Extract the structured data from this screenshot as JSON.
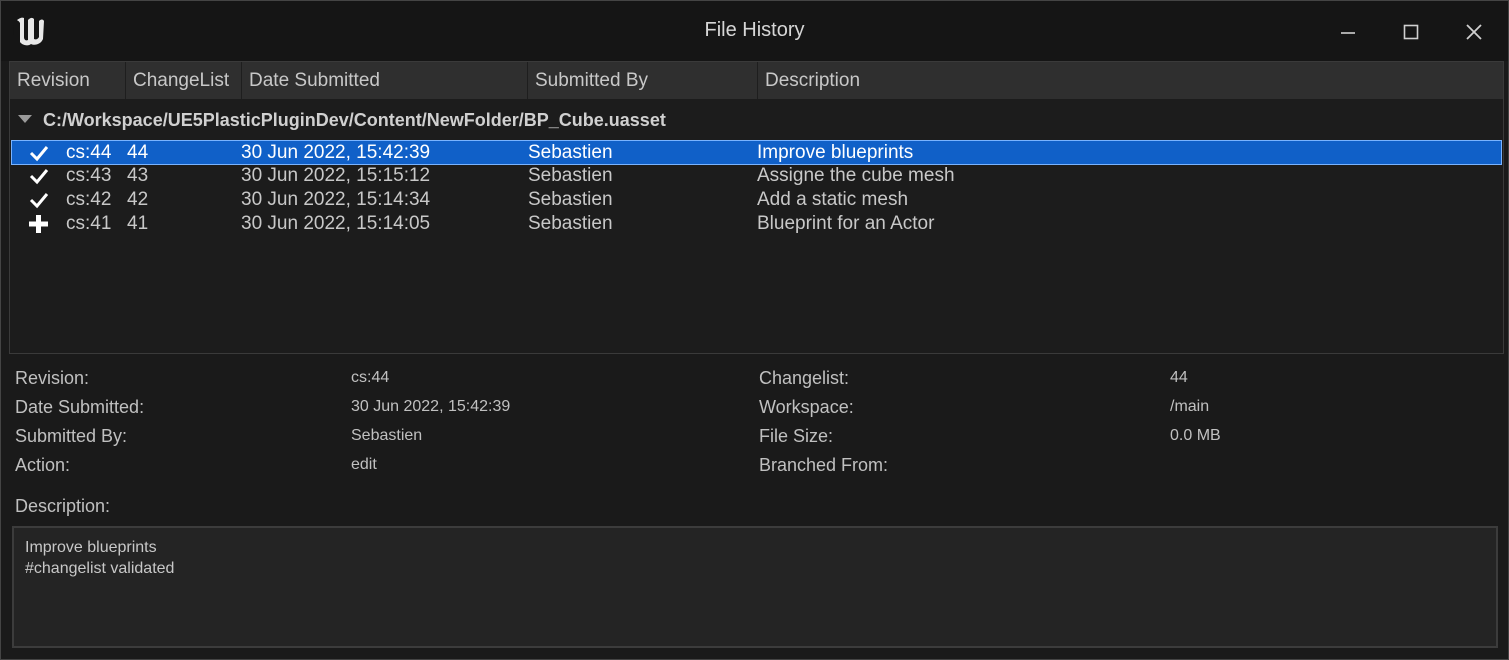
{
  "window": {
    "title": "File History"
  },
  "icons": {
    "logo": "unreal-engine-logo-icon",
    "minimize": "minimize-icon",
    "maximize": "maximize-icon",
    "close": "close-icon"
  },
  "columns": [
    "Revision",
    "ChangeList",
    "Date Submitted",
    "Submitted By",
    "Description"
  ],
  "file_path": "C:/Workspace/UE5PlasticPluginDev/Content/NewFolder/BP_Cube.uasset",
  "rows": [
    {
      "icon": "checkmark-icon",
      "revision": "cs:44",
      "changelist": "44",
      "date": "30 Jun 2022, 15:42:39",
      "user": "Sebastien",
      "description": "Improve blueprints",
      "selected": true
    },
    {
      "icon": "checkmark-icon",
      "revision": "cs:43",
      "changelist": "43",
      "date": "30 Jun 2022, 15:15:12",
      "user": "Sebastien",
      "description": "Assigne the cube mesh",
      "selected": false
    },
    {
      "icon": "checkmark-icon",
      "revision": "cs:42",
      "changelist": "42",
      "date": "30 Jun 2022, 15:14:34",
      "user": "Sebastien",
      "description": "Add a static mesh",
      "selected": false
    },
    {
      "icon": "plus-icon",
      "revision": "cs:41",
      "changelist": "41",
      "date": "30 Jun 2022, 15:14:05",
      "user": "Sebastien",
      "description": "Blueprint for an Actor",
      "selected": false
    }
  ],
  "details": {
    "revision_label": "Revision:",
    "revision": "cs:44",
    "date_label": "Date Submitted:",
    "date": "30 Jun 2022, 15:42:39",
    "user_label": "Submitted By:",
    "user": "Sebastien",
    "action_label": "Action:",
    "action": "edit",
    "changelist_label": "Changelist:",
    "changelist": "44",
    "workspace_label": "Workspace:",
    "workspace": "/main",
    "filesize_label": "File Size:",
    "filesize": "0.0 MB",
    "branched_label": "Branched From:",
    "branched": "",
    "description_label": "Description:",
    "description_line1": "Improve blueprints",
    "description_line2": "#changelist validated"
  },
  "colors": {
    "selection": "#1060c8",
    "background": "#1a1a1a",
    "header": "#2f2f2f"
  }
}
